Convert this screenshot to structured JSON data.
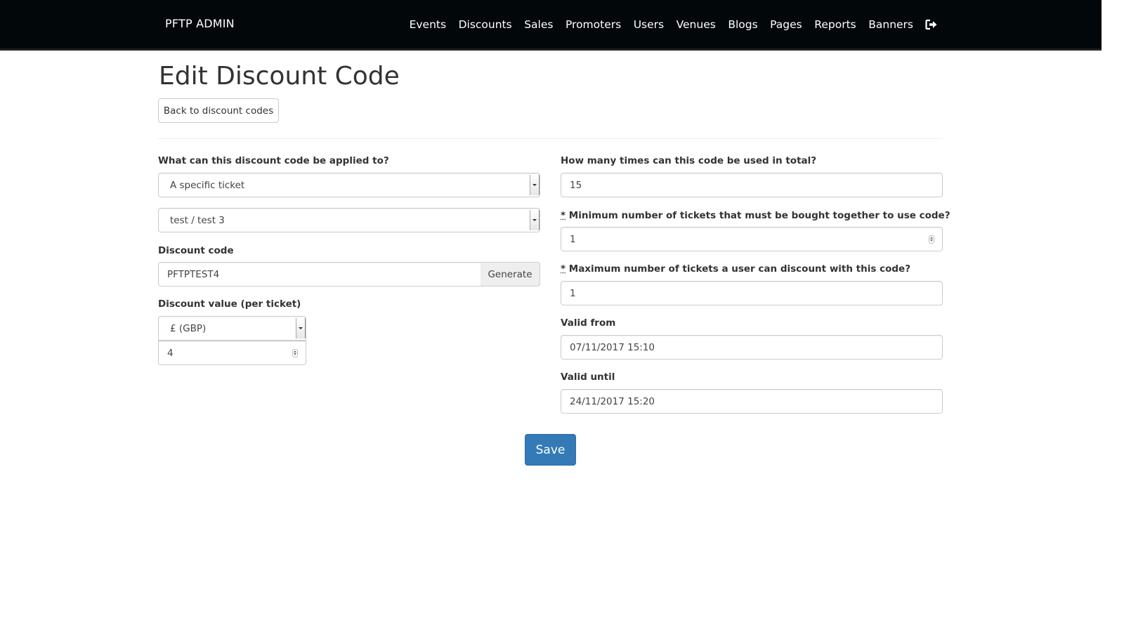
{
  "nav": {
    "brand": "PFTP ADMIN",
    "links": [
      "Events",
      "Discounts",
      "Sales",
      "Promoters",
      "Users",
      "Venues",
      "Blogs",
      "Pages",
      "Reports",
      "Banners"
    ],
    "logout_icon": "sign-out-icon"
  },
  "page": {
    "title": "Edit Discount Code",
    "back_label": "Back to discount codes"
  },
  "left": {
    "applied_label": "What can this discount code be applied to?",
    "applied_value": "A specific ticket",
    "ticket_value": "test / test 3",
    "code_label": "Discount code",
    "code_value": "PFTPTEST4",
    "generate_label": "Generate",
    "value_label": "Discount value (per ticket)",
    "currency_value": "£ (GBP)",
    "amount_value": "4"
  },
  "right": {
    "total_uses_label": "How many times can this code be used in total?",
    "total_uses_value": "15",
    "required_mark": "*",
    "min_tickets_label": "Minimum number of tickets that must be bought together to use code?",
    "min_tickets_value": "1",
    "max_tickets_label": "Maximum number of tickets a user can discount with this code?",
    "max_tickets_value": "1",
    "valid_from_label": "Valid from",
    "valid_from_value": "07/11/2017 15:10",
    "valid_until_label": "Valid until",
    "valid_until_value": "24/11/2017 15:20"
  },
  "actions": {
    "save_label": "Save"
  },
  "colors": {
    "navbar": "#020709",
    "primary": "#337ab7"
  }
}
